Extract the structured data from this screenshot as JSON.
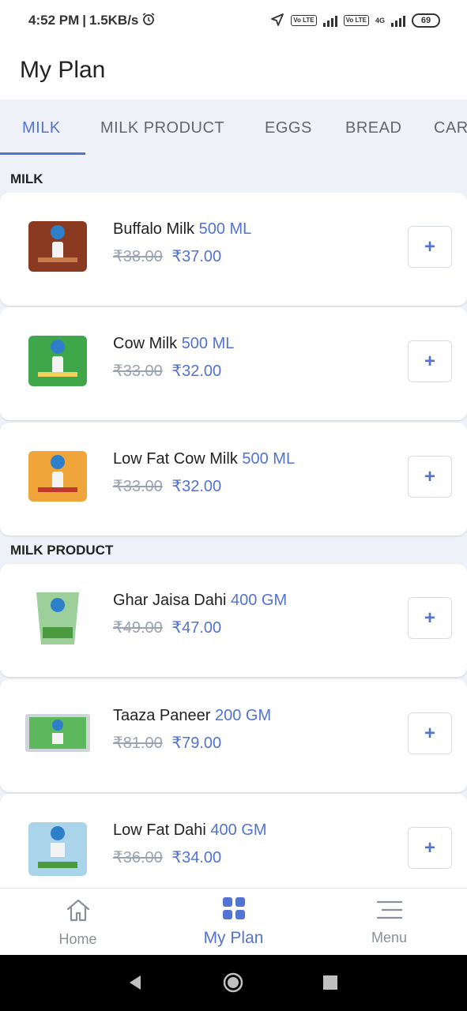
{
  "status_bar": {
    "time": "4:52 PM",
    "speed": "1.5KB/s",
    "alarm_icon": "alarm-icon",
    "location_icon": "location-arrow-icon",
    "lte1": "Vo LTE",
    "lte2": "Vo LTE",
    "net_label": "4G",
    "battery": "69"
  },
  "header": {
    "title": "My Plan"
  },
  "tabs": [
    {
      "label": "MILK",
      "active": true
    },
    {
      "label": "MILK PRODUCT",
      "active": false
    },
    {
      "label": "EGGS",
      "active": false
    },
    {
      "label": "BREAD",
      "active": false
    },
    {
      "label": "CAR",
      "active": false
    }
  ],
  "sections": [
    {
      "title": "MILK",
      "items": [
        {
          "name": "Buffalo Milk",
          "qty": "500 ML",
          "old_price": "₹38.00",
          "new_price": "₹37.00",
          "pack_color": "#8b3a22",
          "add_label": "+"
        },
        {
          "name": "Cow Milk",
          "qty": "500 ML",
          "old_price": "₹33.00",
          "new_price": "₹32.00",
          "pack_color": "#3fa64a",
          "add_label": "+"
        },
        {
          "name": "Low Fat Cow Milk",
          "qty": "500 ML",
          "old_price": "₹33.00",
          "new_price": "₹32.00",
          "pack_color": "#f0a53a",
          "add_label": "+"
        }
      ]
    },
    {
      "title": "MILK PRODUCT",
      "items": [
        {
          "name": "Ghar Jaisa Dahi",
          "qty": "400 GM",
          "old_price": "₹49.00",
          "new_price": "₹47.00",
          "pack_color": "#9ccf9a",
          "add_label": "+"
        },
        {
          "name": "Taaza Paneer",
          "qty": "200 GM",
          "old_price": "₹81.00",
          "new_price": "₹79.00",
          "pack_color": "#5cb85c",
          "add_label": "+"
        },
        {
          "name": "Low Fat Dahi",
          "qty": "400 GM",
          "old_price": "₹36.00",
          "new_price": "₹34.00",
          "pack_color": "#a9d4ea",
          "add_label": "+"
        }
      ]
    }
  ],
  "bottom_nav": [
    {
      "label": "Home",
      "icon": "home-icon",
      "active": false
    },
    {
      "label": "My Plan",
      "icon": "grid-icon",
      "active": true
    },
    {
      "label": "Menu",
      "icon": "menu-icon",
      "active": false
    }
  ],
  "colors": {
    "accent": "#5273d1",
    "background": "#eef2f8",
    "muted": "#9aa3b2"
  }
}
